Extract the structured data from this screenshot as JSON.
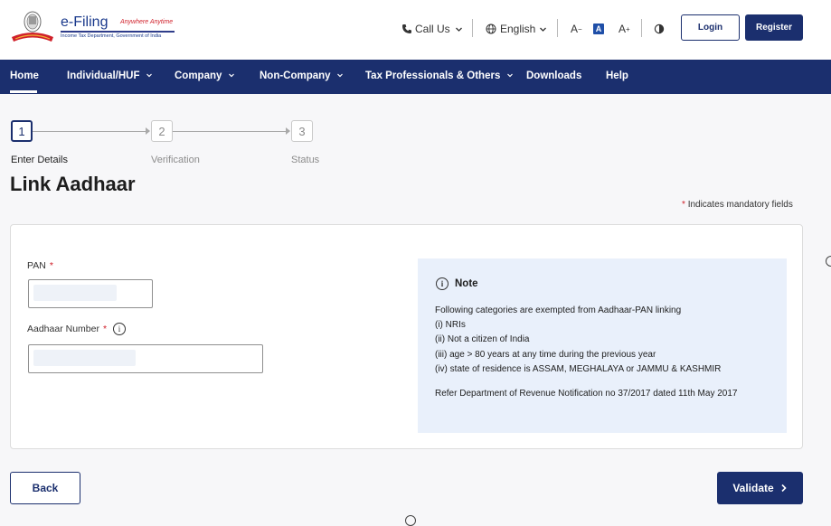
{
  "header": {
    "brand_title": "e-Filing",
    "brand_tagline": "Anywhere Anytime",
    "brand_dept": "Income Tax Department, Government of India",
    "call_us": "Call Us",
    "language": "English",
    "font_decrease": "A",
    "font_normal": "A",
    "font_increase": "A",
    "login": "Login",
    "register": "Register"
  },
  "nav": {
    "items": [
      {
        "label": "Home"
      },
      {
        "label": "Individual/HUF"
      },
      {
        "label": "Company"
      },
      {
        "label": "Non-Company"
      },
      {
        "label": "Tax Professionals & Others"
      },
      {
        "label": "Downloads"
      },
      {
        "label": "Help"
      }
    ]
  },
  "stepper": {
    "steps": [
      {
        "number": "1",
        "label": "Enter Details"
      },
      {
        "number": "2",
        "label": "Verification"
      },
      {
        "number": "3",
        "label": "Status"
      }
    ]
  },
  "page": {
    "title": "Link Aadhaar",
    "mandatory_star": "*",
    "mandatory_note": "Indicates mandatory fields"
  },
  "form": {
    "pan_label": "PAN",
    "aadhaar_label": "Aadhaar Number",
    "required_star": "*"
  },
  "note": {
    "heading": "Note",
    "lines": [
      "Following categories are exempted from Aadhaar-PAN linking",
      "(i) NRIs",
      "(ii) Not a citizen of India",
      "(iii) age > 80 years at any time during the previous year",
      "(iv) state of residence is ASSAM, MEGHALAYA or JAMMU & KASHMIR"
    ],
    "reference": "Refer Department of Revenue Notification no 37/2017 dated 11th May 2017"
  },
  "actions": {
    "back": "Back",
    "validate": "Validate"
  },
  "colors": {
    "primary": "#1b2f6e",
    "accent_red": "#d0202a",
    "note_bg": "#e9f0fb"
  }
}
